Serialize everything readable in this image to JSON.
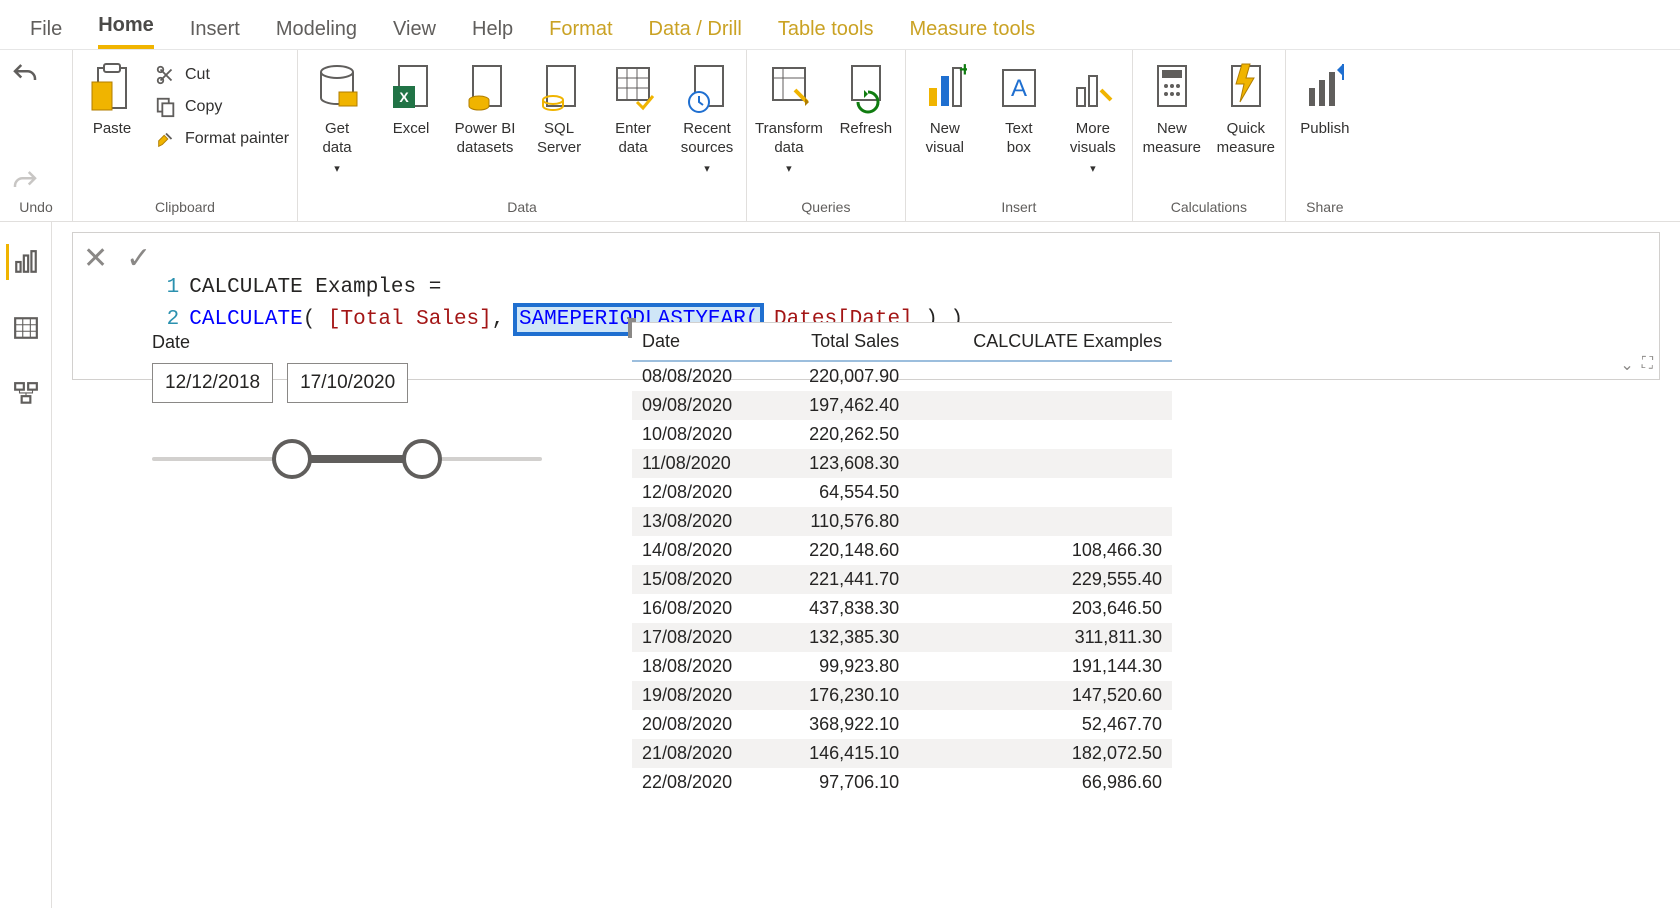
{
  "tabs": {
    "file": "File",
    "home": "Home",
    "insert": "Insert",
    "modeling": "Modeling",
    "view": "View",
    "help": "Help",
    "format": "Format",
    "data_drill": "Data / Drill",
    "table_tools": "Table tools",
    "measure_tools": "Measure tools"
  },
  "ribbon": {
    "undo_group": "Undo",
    "clipboard": {
      "label": "Clipboard",
      "paste": "Paste",
      "cut": "Cut",
      "copy": "Copy",
      "format_painter": "Format painter"
    },
    "data": {
      "label": "Data",
      "get_data": "Get\ndata",
      "excel": "Excel",
      "pbi_datasets": "Power BI\ndatasets",
      "sql_server": "SQL\nServer",
      "enter_data": "Enter\ndata",
      "recent_sources": "Recent\nsources"
    },
    "queries": {
      "label": "Queries",
      "transform": "Transform\ndata",
      "refresh": "Refresh"
    },
    "insert": {
      "label": "Insert",
      "new_visual": "New\nvisual",
      "text_box": "Text\nbox",
      "more_visuals": "More\nvisuals"
    },
    "calculations": {
      "label": "Calculations",
      "new_measure": "New\nmeasure",
      "quick_measure": "Quick\nmeasure"
    },
    "share": {
      "label": "Share",
      "publish": "Publish"
    }
  },
  "formula": {
    "ln1": "1",
    "ln2": "2",
    "line1_text": "CALCULATE Examples =",
    "line2_pre_func": "CALCULATE",
    "line2_open1": "( ",
    "line2_col1": "[Total Sales]",
    "line2_comma": ", ",
    "line2_highlight": "SAMEPERIODLASTYEAR(",
    "line2_col2": "Dates[Date]",
    "line2_close": " ) )"
  },
  "slicer": {
    "title": "Date",
    "start": "12/12/2018",
    "end": "17/10/2020"
  },
  "table": {
    "headers": {
      "c0": "Date",
      "c1": "Total Sales",
      "c2": "CALCULATE Examples"
    },
    "rows": [
      {
        "date": "08/08/2020",
        "sales": "220,007.90",
        "calc": ""
      },
      {
        "date": "09/08/2020",
        "sales": "197,462.40",
        "calc": ""
      },
      {
        "date": "10/08/2020",
        "sales": "220,262.50",
        "calc": ""
      },
      {
        "date": "11/08/2020",
        "sales": "123,608.30",
        "calc": ""
      },
      {
        "date": "12/08/2020",
        "sales": "64,554.50",
        "calc": ""
      },
      {
        "date": "13/08/2020",
        "sales": "110,576.80",
        "calc": ""
      },
      {
        "date": "14/08/2020",
        "sales": "220,148.60",
        "calc": "108,466.30"
      },
      {
        "date": "15/08/2020",
        "sales": "221,441.70",
        "calc": "229,555.40"
      },
      {
        "date": "16/08/2020",
        "sales": "437,838.30",
        "calc": "203,646.50"
      },
      {
        "date": "17/08/2020",
        "sales": "132,385.30",
        "calc": "311,811.30"
      },
      {
        "date": "18/08/2020",
        "sales": "99,923.80",
        "calc": "191,144.30"
      },
      {
        "date": "19/08/2020",
        "sales": "176,230.10",
        "calc": "147,520.60"
      },
      {
        "date": "20/08/2020",
        "sales": "368,922.10",
        "calc": "52,467.70"
      },
      {
        "date": "21/08/2020",
        "sales": "146,415.10",
        "calc": "182,072.50"
      },
      {
        "date": "22/08/2020",
        "sales": "97,706.10",
        "calc": "66,986.60"
      }
    ]
  }
}
